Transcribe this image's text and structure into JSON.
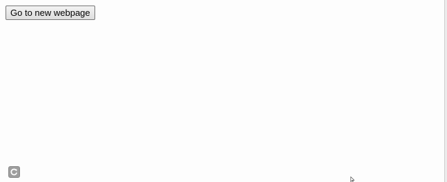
{
  "main": {
    "nav_button_label": "Go to new webpage"
  },
  "icons": {
    "corner": "reload-icon",
    "pointer": "mouse-cursor-icon"
  },
  "colors": {
    "page_background": "#fdfdfd",
    "button_border": "#767676",
    "icon_fill": "#9e9e9e"
  }
}
